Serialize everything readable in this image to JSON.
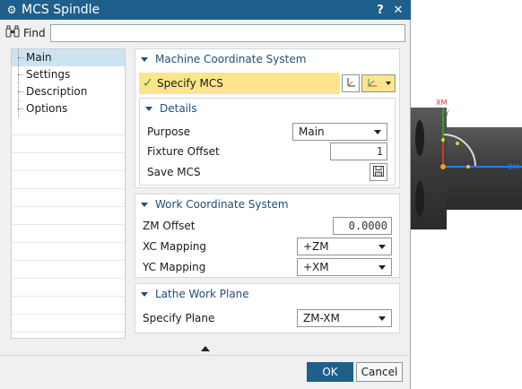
{
  "title": "MCS Spindle",
  "title_buttons": {
    "help": "?",
    "close": "✕"
  },
  "find": {
    "label": "Find",
    "value": "",
    "placeholder": ""
  },
  "nav": {
    "items": [
      {
        "label": "Main",
        "selected": true
      },
      {
        "label": "Settings"
      },
      {
        "label": "Description"
      },
      {
        "label": "Options"
      }
    ]
  },
  "mcs_group": {
    "title": "Machine Coordinate System",
    "specify_label": "Specify MCS",
    "details": {
      "title": "Details",
      "purpose_label": "Purpose",
      "purpose_value": "Main",
      "fixture_offset_label": "Fixture Offset",
      "fixture_offset_value": "1",
      "save_mcs_label": "Save MCS"
    }
  },
  "wcs_group": {
    "title": "Work Coordinate System",
    "zm_offset_label": "ZM Offset",
    "zm_offset_value": "0.0000",
    "xc_mapping_label": "XC Mapping",
    "xc_mapping_value": "+ZM",
    "yc_mapping_label": "YC Mapping",
    "yc_mapping_value": "+XM"
  },
  "lathe_group": {
    "title": "Lathe Work Plane",
    "specify_plane_label": "Specify Plane",
    "specify_plane_value": "ZM-XM"
  },
  "footer": {
    "ok": "OK",
    "cancel": "Cancel"
  },
  "viewport": {
    "axis_x": "XM",
    "axis_y": "Y",
    "axis_z": "ZM",
    "colors": {
      "x_axis": "#e03030",
      "y_axis": "#30a030",
      "z_axis": "#2a7de1"
    }
  }
}
